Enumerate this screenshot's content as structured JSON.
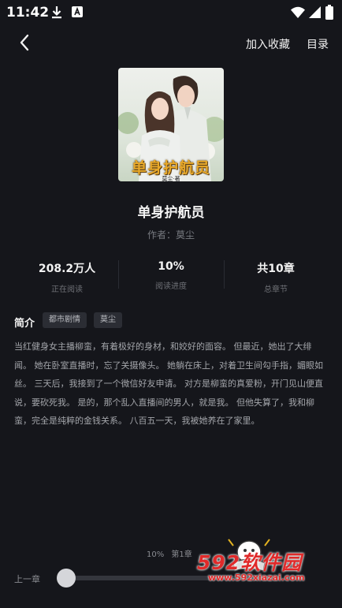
{
  "status_bar": {
    "time": "11:42",
    "icons": [
      "download-icon",
      "a-app-icon",
      "wifi-icon",
      "signal-icon",
      "battery-icon"
    ]
  },
  "nav": {
    "back_icon": "chevron-left-icon",
    "add_to_favorites": "加入收藏",
    "table_of_contents": "目录"
  },
  "book": {
    "cover_title": "单身护航员",
    "cover_author": "莫尘·著",
    "title": "单身护航员",
    "author": "作者：莫尘"
  },
  "stats": [
    {
      "value": "208.2万人",
      "label": "正在阅读"
    },
    {
      "value": "10%",
      "label": "阅读进度"
    },
    {
      "value": "共10章",
      "label": "总章节"
    }
  ],
  "intro": {
    "label": "简介",
    "tags": [
      "都市剧情",
      "莫尘"
    ],
    "text": "当红健身女主播柳蛮，有着极好的身材，和姣好的面容。 但最近，她出了大绯闻。 她在卧室直播时，忘了关摄像头。 她躺在床上，对着卫生间勾手指，媚眼如丝。 三天后，我接到了一个微信好友申请。 对方是柳蛮的真爱粉，开门见山便直说，要砍死我。 是的，那个乱入直播间的男人，就是我。 但他失算了，我和柳蛮，完全是纯粹的金钱关系。 八百五一天，我被她养在了家里。"
  },
  "reader": {
    "progress_percent": "10%",
    "chapter": "第1章",
    "prev_chapter": "上一章",
    "progress_fraction": 0.01
  },
  "watermark": {
    "brand": "592软件园",
    "url": "www.592xiazai.com"
  },
  "colors": {
    "background": "#15161b",
    "cover_title": "#e9a92a",
    "watermark": "#e02a2a"
  }
}
